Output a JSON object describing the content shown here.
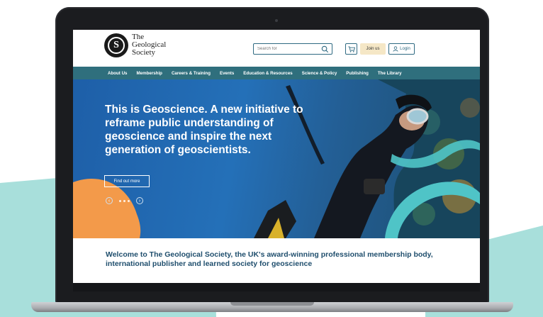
{
  "logo": {
    "line1": "The",
    "line2": "Geological",
    "line3": "Society",
    "monogram": "S"
  },
  "search": {
    "placeholder": "Search for",
    "icon": "search-icon"
  },
  "header": {
    "cart_icon": "cart-icon",
    "join_label": "Join us",
    "login_label": "Login",
    "login_icon": "user-icon"
  },
  "nav": {
    "items": [
      "About Us",
      "Membership",
      "Careers & Training",
      "Events",
      "Education & Resources",
      "Science & Policy",
      "Publishing",
      "The Library"
    ]
  },
  "hero": {
    "title": "This is Geoscience. A new initiative to reframe public understanding of geoscience and inspire the next generation of geoscientists.",
    "button_label": "Find out more",
    "prev_icon": "chevron-left-icon",
    "next_icon": "chevron-right-icon",
    "prev_glyph": "‹",
    "next_glyph": "›"
  },
  "welcome": "Welcome to The Geological Society, the UK's award-winning professional membership body, international publisher and learned society for geoscience",
  "colors": {
    "nav": "#2f6f7d",
    "hero": "#2470b8",
    "accent_orange": "#f39a4a",
    "accent_teal": "#4fc4c7",
    "join": "#f5e7c6"
  }
}
